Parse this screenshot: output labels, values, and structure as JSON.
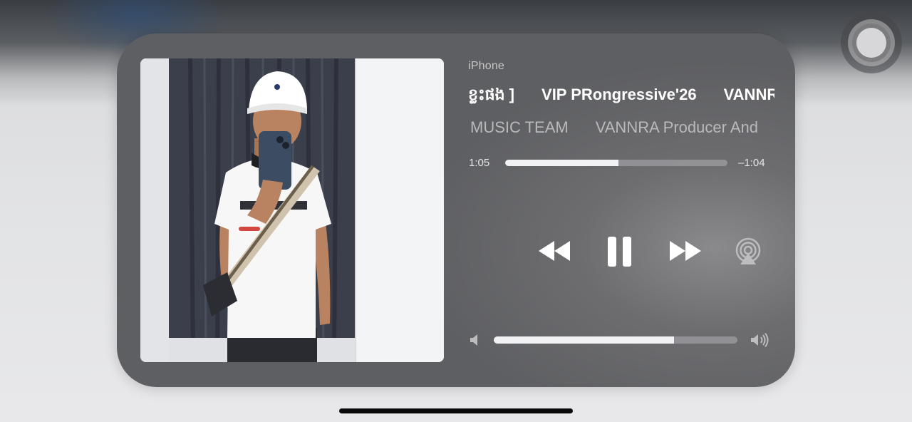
{
  "player": {
    "source_device": "iPhone",
    "track_title_parts": [
      "ខ្លះផង ]",
      "VIP PRongressive'26",
      "VANNRA"
    ],
    "artist_parts": [
      "MUSIC TEAM",
      "VANNRA Producer And"
    ],
    "elapsed_time": "1:05",
    "remaining_time": "–1:04",
    "playback_progress_percent": 51,
    "volume_level_percent": 74,
    "is_playing": true
  },
  "controls": {
    "rewind_icon": "backward-icon",
    "pause_icon": "pause-icon",
    "forward_icon": "forward-icon",
    "airplay_icon": "airplay-audio-icon",
    "volume_low_icon": "speaker-low-icon",
    "volume_high_icon": "speaker-high-icon"
  },
  "colors": {
    "accent": "#ffffff",
    "track_background": "#96969a",
    "panel": "#6d6d70"
  }
}
